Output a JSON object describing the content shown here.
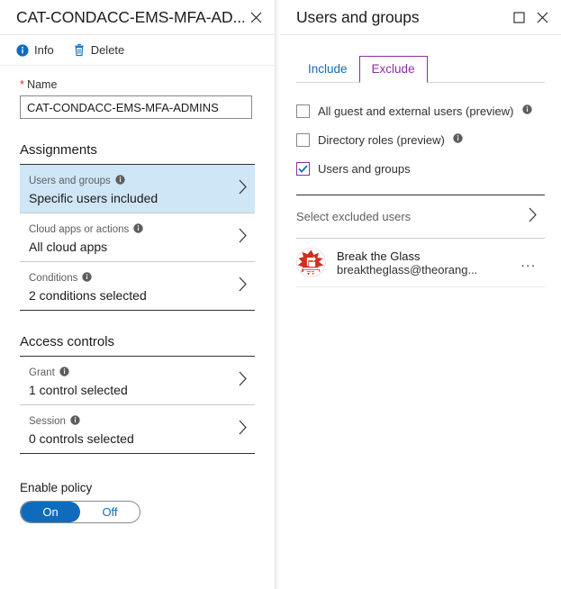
{
  "policy_blade": {
    "title": "CAT-CONDACC-EMS-MFA-AD...",
    "close_icon": "close-icon",
    "commands": [
      {
        "icon": "info-icon",
        "label": "Info"
      },
      {
        "icon": "delete-icon",
        "label": "Delete"
      }
    ],
    "name_field": {
      "required_marker": "*",
      "label": "Name",
      "value": "CAT-CONDACC-EMS-MFA-ADMINS",
      "placeholder": ""
    },
    "assignments": {
      "heading": "Assignments",
      "items": [
        {
          "label": "Users and groups",
          "value": "Specific users included",
          "selected": true
        },
        {
          "label": "Cloud apps or actions",
          "value": "All cloud apps",
          "selected": false
        },
        {
          "label": "Conditions",
          "value": "2 conditions selected",
          "selected": false
        }
      ]
    },
    "access_controls": {
      "heading": "Access controls",
      "items": [
        {
          "label": "Grant",
          "value": "1 control selected",
          "selected": false
        },
        {
          "label": "Session",
          "value": "0 controls selected",
          "selected": false
        }
      ]
    },
    "enable_policy": {
      "label": "Enable policy",
      "on_label": "On",
      "off_label": "Off",
      "state": "On"
    }
  },
  "users_blade": {
    "title": "Users and groups",
    "maximize_icon": "maximize-icon",
    "close_icon": "close-icon",
    "tabs": [
      {
        "label": "Include",
        "active": false
      },
      {
        "label": "Exclude",
        "active": true
      }
    ],
    "checkboxes": [
      {
        "label": "All guest and external users (preview)",
        "checked": false,
        "info": true
      },
      {
        "label": "Directory roles (preview)",
        "checked": false,
        "info": true
      },
      {
        "label": "Users and groups",
        "checked": true,
        "info": false
      }
    ],
    "select_row": {
      "label": "Select excluded users",
      "chevron": "chevron-right-icon"
    },
    "selected_users": [
      {
        "name": "Break the Glass",
        "email": "breaktheglass@theorang...",
        "avatar": "break-glass-avatar",
        "menu": "..."
      }
    ]
  },
  "colors": {
    "accent_blue": "#0f6cbd",
    "selected_row": "#cfe6f7",
    "tab_active_purple": "#8b2fa0",
    "required_red": "#d13438",
    "avatar_red": "#d0301f"
  }
}
